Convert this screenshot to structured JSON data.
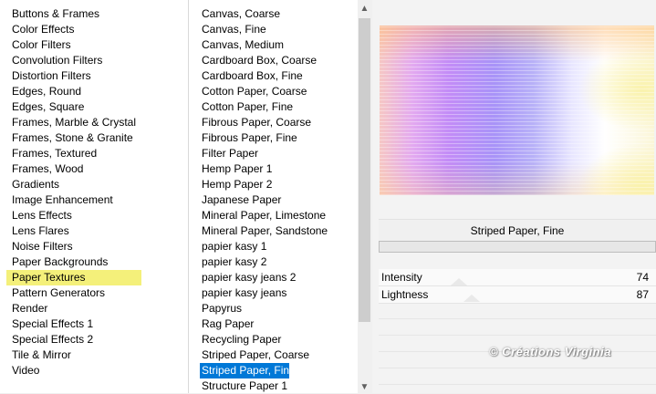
{
  "categories": {
    "items": [
      "Buttons & Frames",
      "Color Effects",
      "Color Filters",
      "Convolution Filters",
      "Distortion Filters",
      "Edges, Round",
      "Edges, Square",
      "Frames, Marble & Crystal",
      "Frames, Stone & Granite",
      "Frames, Textured",
      "Frames, Wood",
      "Gradients",
      "Image Enhancement",
      "Lens Effects",
      "Lens Flares",
      "Noise Filters",
      "Paper Backgrounds",
      "Paper Textures",
      "Pattern Generators",
      "Render",
      "Special Effects 1",
      "Special Effects 2",
      "Tile & Mirror",
      "Video"
    ],
    "highlighted": "Paper Textures",
    "highlight_color": "#f4f07a"
  },
  "textures": {
    "items": [
      "Canvas, Coarse",
      "Canvas, Fine",
      "Canvas, Medium",
      "Cardboard Box, Coarse",
      "Cardboard Box, Fine",
      "Cotton Paper, Coarse",
      "Cotton Paper, Fine",
      "Fibrous Paper, Coarse",
      "Fibrous Paper, Fine",
      "Filter Paper",
      "Hemp Paper 1",
      "Hemp Paper 2",
      "Japanese Paper",
      "Mineral Paper, Limestone",
      "Mineral Paper, Sandstone",
      "papier kasy 1",
      "papier kasy 2",
      "papier kasy jeans 2",
      "papier kasy jeans",
      "Papyrus",
      "Rag Paper",
      "Recycling Paper",
      "Striped Paper, Coarse",
      "Striped Paper, Fine",
      "Structure Paper 1"
    ],
    "selected": "Striped Paper, Fine",
    "selected_color": "#0078d7"
  },
  "scrollbar": {
    "up_icon": "▲",
    "down_icon": "▼"
  },
  "preview": {
    "texture_name": "Striped Paper, Fine"
  },
  "params": [
    {
      "name": "Intensity",
      "value": "74"
    },
    {
      "name": "Lightness",
      "value": "87"
    }
  ],
  "watermark": "© Créations Virginia"
}
